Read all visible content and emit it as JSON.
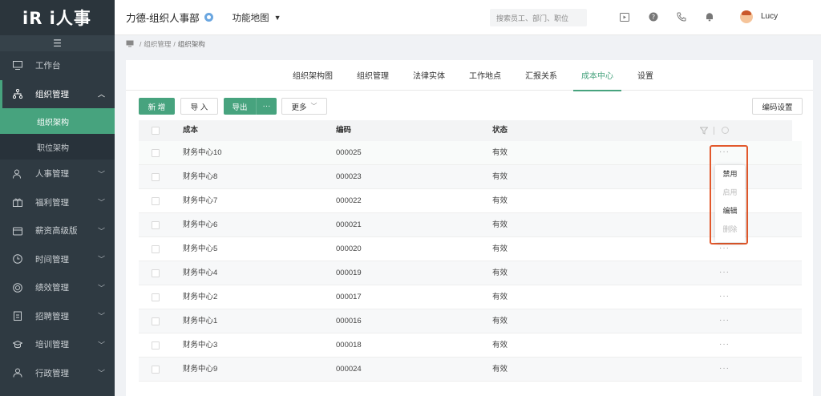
{
  "app": {
    "logo_text": "iR i人事"
  },
  "sidebar": {
    "collapse_icon": "menu-icon",
    "items": [
      {
        "label": "工作台",
        "icon": "monitor-icon"
      },
      {
        "label": "组织管理",
        "icon": "org-tree-icon",
        "expanded": true,
        "children": [
          {
            "label": "组织架构",
            "active": true
          },
          {
            "label": "职位架构"
          }
        ]
      },
      {
        "label": "人事管理",
        "icon": "user-icon"
      },
      {
        "label": "福利管理",
        "icon": "gift-icon"
      },
      {
        "label": "薪资高级版",
        "icon": "wallet-icon"
      },
      {
        "label": "时间管理",
        "icon": "clock-icon"
      },
      {
        "label": "绩效管理",
        "icon": "target-icon"
      },
      {
        "label": "招聘管理",
        "icon": "clipboard-icon"
      },
      {
        "label": "培训管理",
        "icon": "graduation-icon"
      },
      {
        "label": "行政管理",
        "icon": "person-icon"
      }
    ]
  },
  "header": {
    "company": "力德-组织人事部",
    "function_map": "功能地图",
    "search_placeholder": "搜索员工、部门、职位",
    "username": "Lucy"
  },
  "breadcrumb": {
    "home_icon": "monitor-icon",
    "items": [
      "组织管理",
      "组织架构"
    ]
  },
  "tabs": [
    {
      "label": "组织架构图"
    },
    {
      "label": "组织管理"
    },
    {
      "label": "法律实体"
    },
    {
      "label": "工作地点"
    },
    {
      "label": "汇报关系"
    },
    {
      "label": "成本中心",
      "active": true
    },
    {
      "label": "设置"
    }
  ],
  "toolbar": {
    "new_label": "新 增",
    "import_label": "导 入",
    "export_label": "导出",
    "export_more": "···",
    "more_label": "更多",
    "code_settings_label": "编码设置"
  },
  "table": {
    "columns": [
      "成本",
      "编码",
      "状态"
    ],
    "rows": [
      {
        "name": "财务中心10",
        "code": "000025",
        "status": "有效"
      },
      {
        "name": "财务中心8",
        "code": "000023",
        "status": "有效"
      },
      {
        "name": "财务中心7",
        "code": "000022",
        "status": "有效"
      },
      {
        "name": "财务中心6",
        "code": "000021",
        "status": "有效"
      },
      {
        "name": "财务中心5",
        "code": "000020",
        "status": "有效"
      },
      {
        "name": "财务中心4",
        "code": "000019",
        "status": "有效"
      },
      {
        "name": "财务中心2",
        "code": "000017",
        "status": "有效"
      },
      {
        "name": "财务中心1",
        "code": "000016",
        "status": "有效"
      },
      {
        "name": "财务中心3",
        "code": "000018",
        "status": "有效"
      },
      {
        "name": "财务中心9",
        "code": "000024",
        "status": "有效"
      }
    ],
    "row_action": "···"
  },
  "popup_menu": {
    "items": [
      {
        "label": "禁用",
        "disabled": false
      },
      {
        "label": "启用",
        "disabled": true
      },
      {
        "label": "编辑",
        "disabled": false
      },
      {
        "label": "删除",
        "disabled": true
      }
    ]
  },
  "colors": {
    "accent": "#47a37e",
    "sidebar_bg": "#2f3a42",
    "highlight_outline": "#e2592c"
  }
}
